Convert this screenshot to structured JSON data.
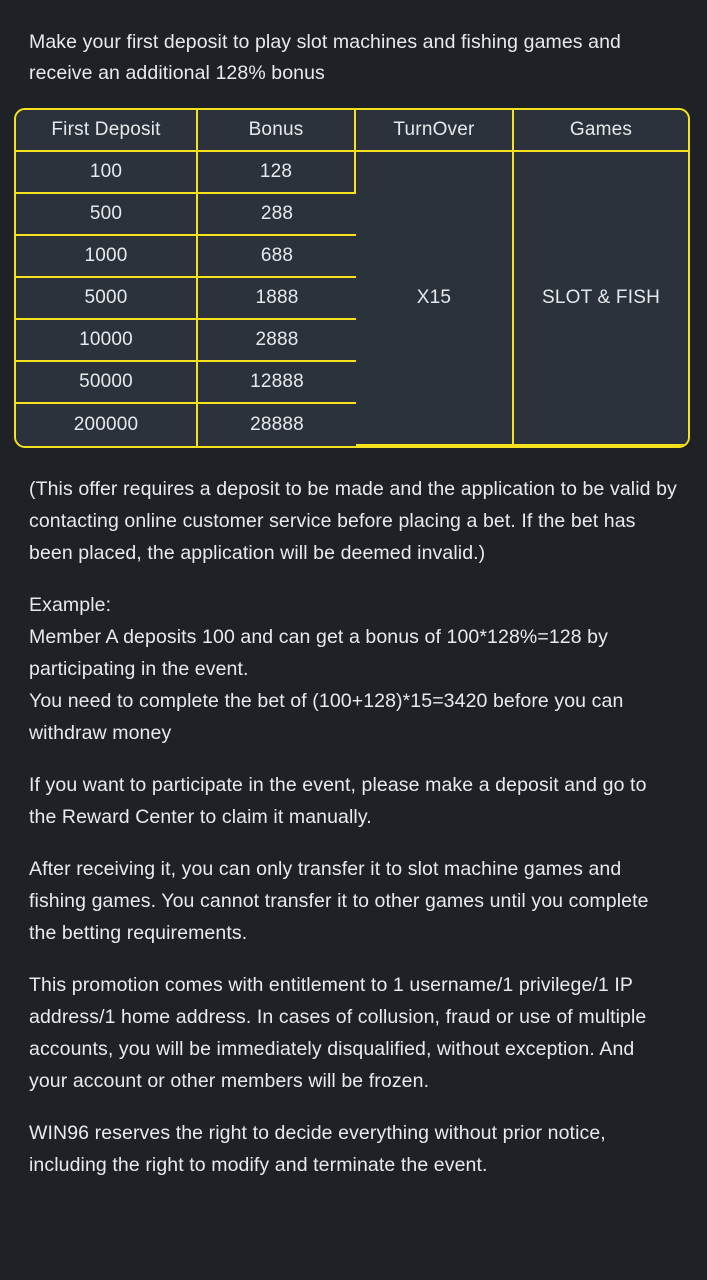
{
  "intro": "Make your first deposit to play slot machines and fishing games and receive an additional 128% bonus",
  "table": {
    "headers": {
      "first_deposit": "First Deposit",
      "bonus": "Bonus",
      "turnover": "TurnOver",
      "games": "Games"
    },
    "rows": [
      {
        "first_deposit": "100",
        "bonus": "128"
      },
      {
        "first_deposit": "500",
        "bonus": "288"
      },
      {
        "first_deposit": "1000",
        "bonus": "688"
      },
      {
        "first_deposit": "5000",
        "bonus": "1888"
      },
      {
        "first_deposit": "10000",
        "bonus": "2888"
      },
      {
        "first_deposit": "50000",
        "bonus": "12888"
      },
      {
        "first_deposit": "200000",
        "bonus": "28888"
      }
    ],
    "turnover_value": "X15",
    "games_value": "SLOT & FISH",
    "border_color": "#f5e11e",
    "cell_background": "#2b323b"
  },
  "paragraphs": {
    "disclaimer": "(This offer requires a deposit to be made and the application to be valid by contacting online customer service before placing a bet. If the bet has been placed, the application will be deemed invalid.)",
    "example_label": "Example:",
    "example_line1": "Member A deposits 100 and can get a bonus of 100*128%=128 by participating in the event.",
    "example_line2": "You need to complete the bet of (100+128)*15=3420 before you can withdraw money",
    "participate": "If you want to participate in the event, please make a deposit and go to the Reward Center to claim it manually.",
    "transfer": "After receiving it, you can only transfer it to slot machine games and fishing games. You cannot transfer it to other games until you complete the betting requirements.",
    "entitlement": "This promotion comes with entitlement to 1 username/1 privilege/1 IP address/1 home address. In cases of collusion, fraud or use of multiple accounts, you will be immediately disqualified, without exception. And your account or other members will be frozen.",
    "rights": "WIN96 reserves the right to decide everything without prior notice, including the right to modify and terminate the event."
  },
  "theme": {
    "page_background": "#1e2227",
    "text_color": "#e8eaec",
    "accent": "#f5e11e"
  }
}
